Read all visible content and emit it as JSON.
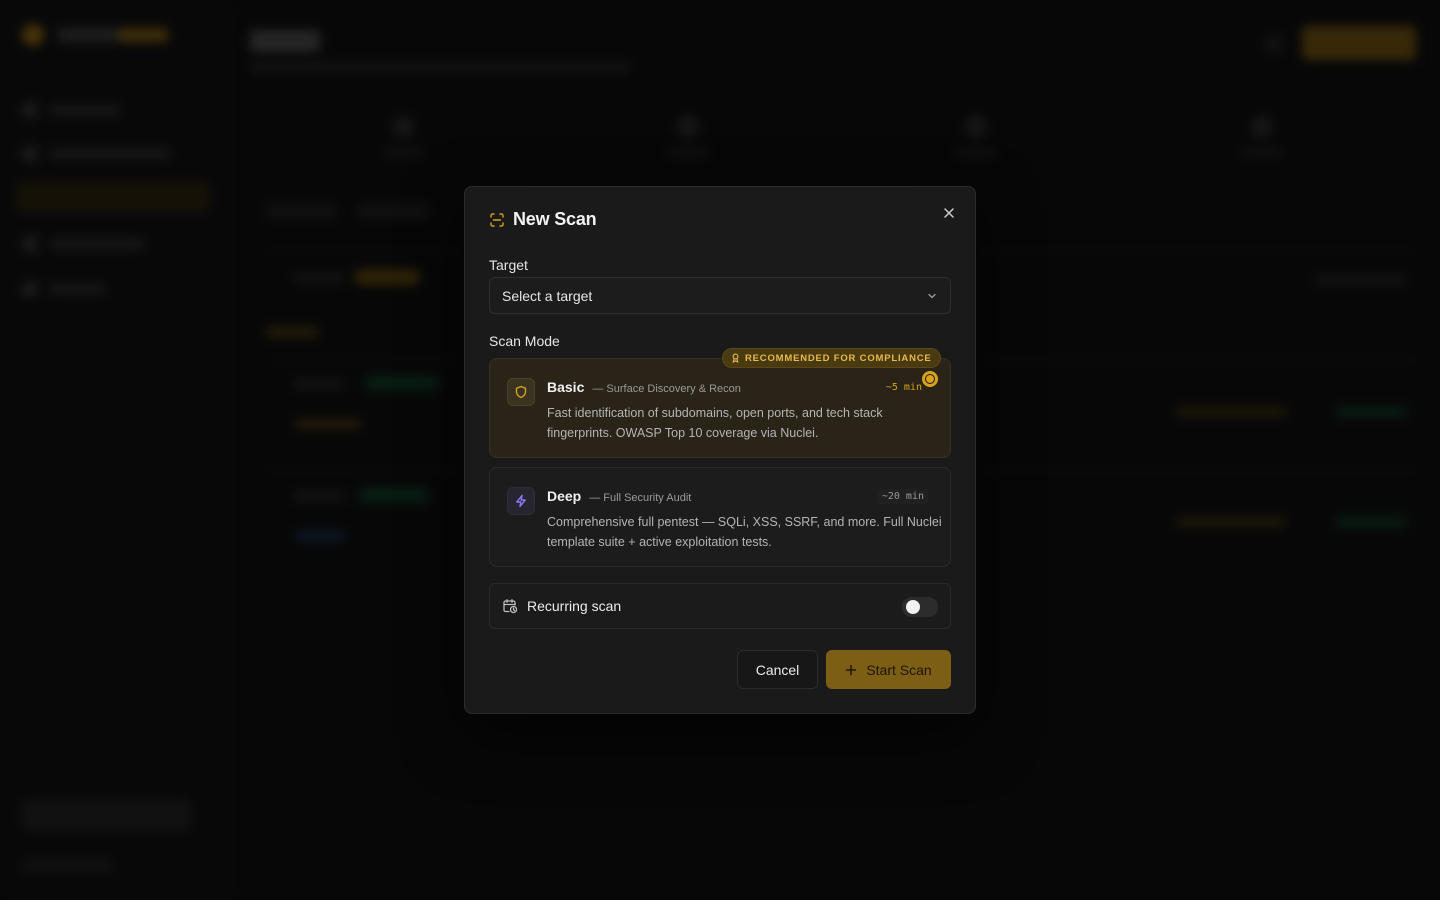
{
  "modal": {
    "title": "New Scan",
    "target_label": "Target",
    "target_placeholder": "Select a target",
    "scan_mode_label": "Scan Mode",
    "modes": [
      {
        "name": "Basic",
        "subtitle": "— Surface Discovery & Recon",
        "time": "~5 min",
        "description": "Fast identification of subdomains, open ports, and tech stack fingerprints. OWASP Top 10 coverage via Nuclei.",
        "badge": "RECOMMENDED FOR COMPLIANCE",
        "selected": true,
        "icon": "shield-icon"
      },
      {
        "name": "Deep",
        "subtitle": "— Full Security Audit",
        "time": "~20 min",
        "description": "Comprehensive full pentest — SQLi, XSS, SSRF, and more. Full Nuclei template suite + active exploitation tests.",
        "selected": false,
        "icon": "lightning-icon"
      }
    ],
    "recurring_label": "Recurring scan",
    "recurring_enabled": false,
    "cancel_label": "Cancel",
    "start_label": "Start Scan"
  },
  "colors": {
    "accent": "#d9a21c",
    "deep_icon": "#8b7cf6",
    "modal_bg": "#1a1a1b"
  }
}
